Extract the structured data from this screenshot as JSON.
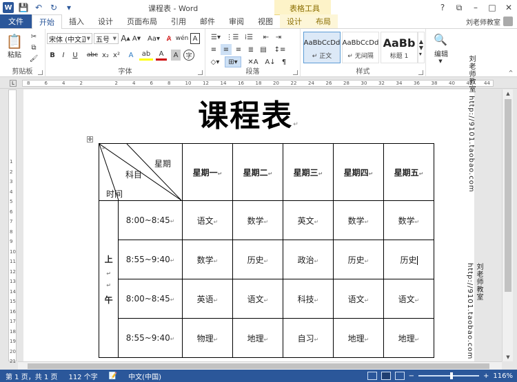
{
  "window": {
    "title": "课程表 - Word",
    "context_tools": "表格工具",
    "controls": [
      "?",
      "⧉",
      "–",
      "□",
      "✕"
    ]
  },
  "qat": {
    "save_icon": "💾",
    "undo_icon": "↶",
    "redo_icon": "↻",
    "customize_icon": "▾"
  },
  "tabs": {
    "file": "文件",
    "items": [
      "开始",
      "插入",
      "设计",
      "页面布局",
      "引用",
      "邮件",
      "审阅",
      "视图"
    ],
    "context": [
      "设计",
      "布局"
    ],
    "user": "刘老师教室"
  },
  "ribbon": {
    "clipboard": {
      "paste": "粘贴",
      "label": "剪贴板"
    },
    "font": {
      "label": "字体",
      "font_name": "宋体 (中文正文)",
      "font_size": "五号",
      "buttons": [
        "B",
        "I",
        "U",
        "abc",
        "x₂",
        "x²"
      ]
    },
    "paragraph": {
      "label": "段落"
    },
    "styles": {
      "label": "样式",
      "items": [
        {
          "sample": "AaBbCcDd",
          "name": "↵ 正文"
        },
        {
          "sample": "AaBbCcDd",
          "name": "↵ 无间隔"
        },
        {
          "sample": "AaBb",
          "name": "标题 1"
        }
      ]
    },
    "editing": {
      "label": "编辑"
    }
  },
  "ruler": {
    "numbers": [
      "8",
      "6",
      "4",
      "2",
      "",
      "2",
      "4",
      "6",
      "8",
      "10",
      "12",
      "14",
      "16",
      "18",
      "20",
      "22",
      "24",
      "26",
      "28",
      "30",
      "32",
      "34",
      "36",
      "38",
      "40",
      "42",
      "44"
    ],
    "vnumbers": [
      "1",
      "2",
      "3",
      "4",
      "5",
      "6",
      "7",
      "8",
      "9",
      "10",
      "11",
      "12",
      "13",
      "14",
      "15",
      "16",
      "17",
      "18",
      "19",
      "20",
      "21"
    ]
  },
  "document": {
    "heading": "课程表",
    "table": {
      "diag": {
        "day": "星期",
        "subject": "科目",
        "time": "时间"
      },
      "days": [
        "星期一",
        "星期二",
        "星期三",
        "星期四",
        "星期五"
      ],
      "period": [
        "上",
        "午"
      ],
      "rows": [
        {
          "time": "8:00~8:45",
          "subjects": [
            "语文",
            "数学",
            "英文",
            "数学",
            "数学"
          ]
        },
        {
          "time": "8:55~9:40",
          "subjects": [
            "数学",
            "历史",
            "政治",
            "历史",
            "历史"
          ]
        },
        {
          "time": "8:00~8:45",
          "subjects": [
            "英语",
            "语文",
            "科技",
            "语文",
            "语文"
          ]
        },
        {
          "time": "8:55~9:40",
          "subjects": [
            "物理",
            "地理",
            "自习",
            "地理",
            "地理"
          ]
        }
      ]
    },
    "watermark": "刘老师教室 http://9101.taobao.com"
  },
  "status": {
    "page": "第 1 页，共 1 页",
    "words": "112 个字",
    "lang": "中文(中国)",
    "zoom": "116%"
  }
}
